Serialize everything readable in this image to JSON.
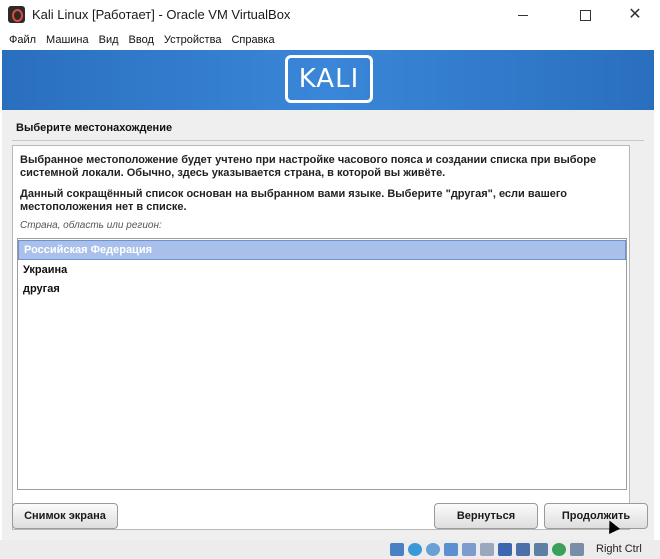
{
  "window": {
    "title": "Kali Linux [Работает] - Oracle VM VirtualBox",
    "minimize": "—",
    "maximize": "☐",
    "close": "✕"
  },
  "menubar": {
    "items": [
      "Файл",
      "Машина",
      "Вид",
      "Ввод",
      "Устройства",
      "Справка"
    ]
  },
  "installer": {
    "logo_text": "KALI",
    "heading": "Выберите местонахождение",
    "paragraph1": "Выбранное местоположение будет учтено при настройке часового пояса и создании списка при выборе системной локали. Обычно, здесь указывается страна, в которой вы живёте.",
    "paragraph2": "Данный сокращённый список основан на выбранном вами языке. Выберите \"другая\", если вашего местоположения нет в списке.",
    "prompt": "Страна, область или регион:",
    "options": [
      "Российская Федерация",
      "Украина",
      "другая"
    ],
    "selected_option": "Российская Федерация",
    "screenshot_button": "Снимок экрана",
    "back_button": "Вернуться",
    "continue_button": "Продолжить"
  },
  "statusbar": {
    "host_key": "Right Ctrl",
    "icons": [
      "audio-icon",
      "network-icon",
      "usb-icon",
      "shared-folder-icon",
      "drag-drop-icon",
      "display-icon",
      "screen-icon",
      "recording-icon",
      "cpu-icon",
      "globe-icon",
      "arrow-icon"
    ]
  },
  "colors": {
    "banner": "#3a86d8",
    "selection": "#a9c1ea"
  }
}
